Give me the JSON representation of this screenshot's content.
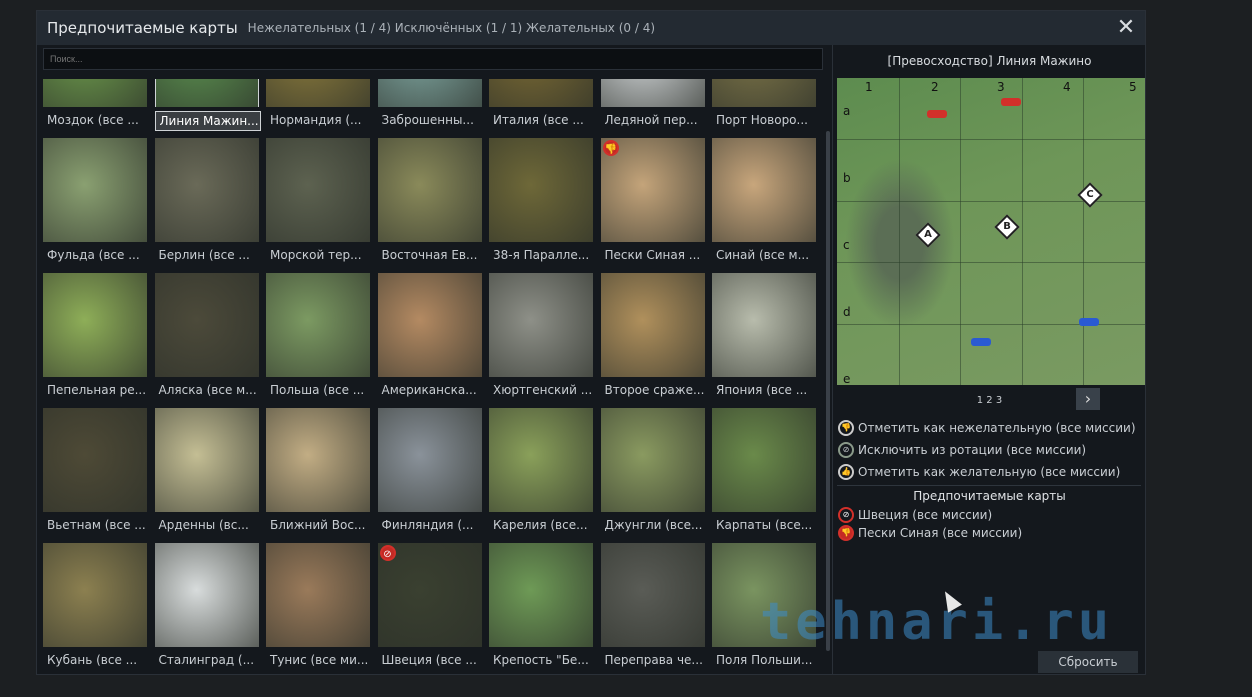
{
  "header": {
    "title": "Предпочитаемые карты",
    "counts": "Нежелательных (1 / 4) Исключённых (1 / 1) Желательных (0 / 4)"
  },
  "search": {
    "placeholder": "Поиск..."
  },
  "maps": [
    {
      "label": "Моздок  (все ...",
      "color": "#6d9a4c"
    },
    {
      "label": "Линия Мажин...",
      "color": "#5c9150",
      "selected": true
    },
    {
      "label": "Нормандия  (...",
      "color": "#8a7a3c"
    },
    {
      "label": "Заброшенны...",
      "color": "#7fa6a0"
    },
    {
      "label": "Италия  (все ...",
      "color": "#7a6a34"
    },
    {
      "label": "Ледяной пер...",
      "color": "#d4d8da"
    },
    {
      "label": "Порт Новоро...",
      "color": "#7c7448"
    },
    {
      "label": "Фульда  (все ...",
      "color": "#8aa071"
    },
    {
      "label": "Берлин  (все ...",
      "color": "#6a6a58"
    },
    {
      "label": "Морской тер...",
      "color": "#5d6250"
    },
    {
      "label": "Восточная Ев...",
      "color": "#8a8a5a"
    },
    {
      "label": "38-я Паралле...",
      "color": "#6e6838"
    },
    {
      "label": "Пески Синая  ...",
      "color": "#c4a47a",
      "badge": "dislike"
    },
    {
      "label": "Синай  (все м...",
      "color": "#c8a67c"
    },
    {
      "label": "Пепельная ре...",
      "color": "#8eae58"
    },
    {
      "label": "Аляска  (все м...",
      "color": "#4c4a3a"
    },
    {
      "label": "Польша  (все ...",
      "color": "#7c9a62"
    },
    {
      "label": "Американска...",
      "color": "#b48a62"
    },
    {
      "label": "Хюртгенский ...",
      "color": "#8e9088"
    },
    {
      "label": "Второе сраже...",
      "color": "#b0905c"
    },
    {
      "label": "Япония  (все ...",
      "color": "#b8bcac"
    },
    {
      "label": "Вьетнам  (все ...",
      "color": "#4e4a36"
    },
    {
      "label": "Арденны  (вс...",
      "color": "#c4be94"
    },
    {
      "label": "Ближний Вос...",
      "color": "#c2ad84"
    },
    {
      "label": "Финляндия  (...",
      "color": "#8a929a"
    },
    {
      "label": "Карелия  (все...",
      "color": "#8aa05a"
    },
    {
      "label": "Джунгли  (все...",
      "color": "#8a9a60"
    },
    {
      "label": "Карпаты  (все...",
      "color": "#6a8a4a"
    },
    {
      "label": "Кубань  (все ...",
      "color": "#8c8050"
    },
    {
      "label": "Сталинград  (...",
      "color": "#d8dcdc"
    },
    {
      "label": "Тунис  (все ми...",
      "color": "#9a7a5a"
    },
    {
      "label": "Швеция  (все ...",
      "color": "#3a4030",
      "badge": "banned"
    },
    {
      "label": "Крепость \"Бе...",
      "color": "#6e9a56"
    },
    {
      "label": "Переправа че...",
      "color": "#5a5c56"
    },
    {
      "label": "Поля Польши...",
      "color": "#7a9460"
    }
  ],
  "preview": {
    "title": "[Превосходство] Линия Мажино",
    "cols": [
      "1",
      "2",
      "3",
      "4",
      "5"
    ],
    "rows": [
      "a",
      "b",
      "c",
      "d",
      "e"
    ],
    "caps": [
      "A",
      "B",
      "C"
    ],
    "pages": "1 2 3"
  },
  "actions": [
    {
      "label": "Отметить как нежелательную  (все миссии)",
      "icon": "dislike"
    },
    {
      "label": "Исключить из ротации  (все миссии)",
      "icon": "ban"
    },
    {
      "label": "Отметить как желательную  (все миссии)",
      "icon": "like"
    }
  ],
  "prefs": {
    "title": "Предпочитаемые карты",
    "items": [
      {
        "label": "Швеция  (все миссии)",
        "icon": "ban"
      },
      {
        "label": "Пески Синая  (все миссии)",
        "icon": "dislike"
      }
    ]
  },
  "reset_label": "Сбросить",
  "watermark": "tehnari.ru",
  "colors": {
    "red": "#d2302a",
    "blue": "#2a5ad2"
  }
}
